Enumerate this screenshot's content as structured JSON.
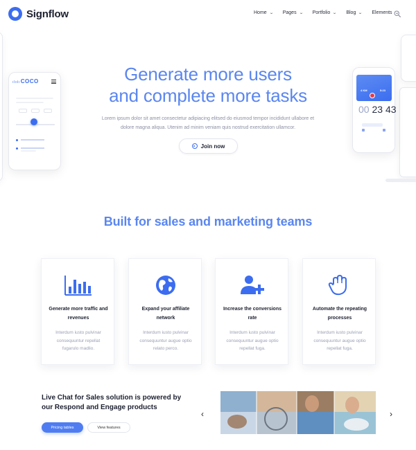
{
  "brand": {
    "name": "Signflow",
    "accent": "#3c6df0",
    "title_color": "#5a86ef"
  },
  "nav": {
    "items": [
      {
        "label": "Home",
        "has_dropdown": true
      },
      {
        "label": "Pages",
        "has_dropdown": true
      },
      {
        "label": "Portfolio",
        "has_dropdown": true
      },
      {
        "label": "Blog",
        "has_dropdown": true
      },
      {
        "label": "Elements",
        "has_dropdown": true
      }
    ],
    "search_icon": "search-icon"
  },
  "hero": {
    "title_line1": "Generate more users",
    "title_line2": "and complete more tasks",
    "description": "Lorem ipsum dolor sit amet consectetur adipiacing elitsed do eiusmod tempor incididunt ullabore et dolore magna aliqua. Utenim ad minim veniam quis nostrud exercitation ullamcor.",
    "cta_label": "Join now",
    "left_phone": {
      "logo": "COCO"
    },
    "right_phone": {
      "distance": "4 KM",
      "split": "5:23",
      "timer_h": "00",
      "timer_m": "23",
      "timer_s": "43"
    }
  },
  "features": {
    "title": "Built for sales and marketing teams",
    "cards": [
      {
        "icon": "bar-chart-icon",
        "title": "Generate more traffic and revenues",
        "text": "Interdum iusto pulvinar consequuntur repellat fugarulo madlio."
      },
      {
        "icon": "globe-icon",
        "title": "Expand your affiliate network",
        "text": "Interdum iusto pulvinar consequuntur augue optio relato perco."
      },
      {
        "icon": "add-user-icon",
        "title": "Increase the conversions rate",
        "text": "Interdum iusto pulvinar consequuntur augue optio repellat fuga."
      },
      {
        "icon": "hand-icon",
        "title": "Automate the repeating processes",
        "text": "Interdum iusto pulvinar consequuntur augue optio repellat fuga."
      }
    ]
  },
  "live_chat": {
    "title": "Live Chat for Sales solution is powered by our Respond and Engage products",
    "primary_button": "Pricing tables",
    "secondary_button": "View features",
    "prev_arrow": "‹",
    "next_arrow": "›"
  }
}
